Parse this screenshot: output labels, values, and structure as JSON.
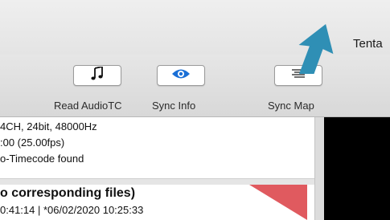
{
  "window": {
    "title": "Tenta"
  },
  "toolbar": {
    "buttons": [
      {
        "id": "read-audiotc",
        "label": "Read AudioTC",
        "icon": "music-note-icon"
      },
      {
        "id": "sync-info",
        "label": "Sync Info",
        "icon": "eye-icon"
      },
      {
        "id": "sync-map",
        "label": "Sync Map",
        "icon": "list-lines-icon"
      }
    ]
  },
  "file_info": {
    "line1": "4CH, 24bit, 48000Hz",
    "line2": ":00 (25.00fps)",
    "line3": "o-Timecode found"
  },
  "second_entry": {
    "title": "o corresponding files)",
    "timestamps": "0:41:14 | *06/02/2020 10:25:33",
    "flag_color": "#e05a5f"
  },
  "colors": {
    "accent_blue": "#1a6fd6",
    "arrow_teal": "#2f8fb5",
    "flag_red": "#e05a5f"
  }
}
